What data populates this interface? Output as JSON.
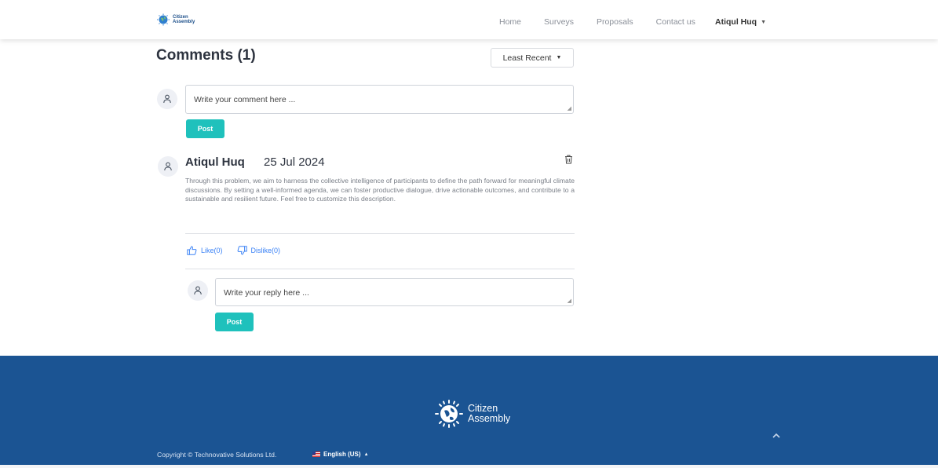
{
  "navbar": {
    "brand": {
      "line1": "Citizen",
      "line2": "Assembly"
    },
    "links": [
      "Home",
      "Surveys",
      "Proposals",
      "Contact us"
    ],
    "user": "Atiqul Huq"
  },
  "comments": {
    "title": "Comments (1)",
    "sort_label": "Least Recent",
    "input_placeholder": "Write your comment here ...",
    "post_label": "Post"
  },
  "comment": {
    "author": "Atiqul Huq",
    "date": "25 Jul 2024",
    "body": "Through this problem, we aim to harness the collective intelligence of participants to define the path forward for meaningful climate discussions. By setting a well-informed agenda, we can foster productive dialogue, drive actionable outcomes, and contribute to a sustainable and resilient future. Feel free to customize this description.",
    "like_label": "Like(0)",
    "dislike_label": "Dislike(0)",
    "reply_placeholder": "Write your reply here ...",
    "reply_post_label": "Post"
  },
  "footer": {
    "brand_line1": "Citizen",
    "brand_line2": "Assembly",
    "copyright": "Copyright © Technovative Solutions Ltd.",
    "language": "English (US)"
  },
  "colors": {
    "accent": "#1fc1bc",
    "footer_bg": "#1b5493",
    "link": "#3b82f6"
  }
}
